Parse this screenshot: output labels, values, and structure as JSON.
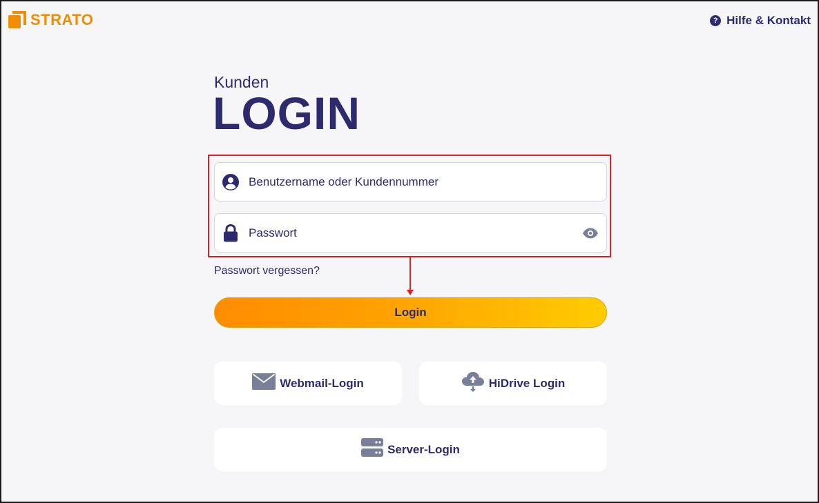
{
  "brand": {
    "name": "STRATO",
    "color": "#f28c00"
  },
  "header": {
    "help_label": "Hilfe & Kontakt",
    "help_icon": "question-circle-icon"
  },
  "headline": {
    "small": "Kunden",
    "big": "LOGIN"
  },
  "form": {
    "username": {
      "placeholder": "Benutzername oder Kundennummer",
      "value": "",
      "icon": "user-circle-icon"
    },
    "password": {
      "placeholder": "Passwort",
      "value": "",
      "icon": "lock-icon",
      "toggle_icon": "eye-icon"
    },
    "forgot_label": "Passwort vergessen?",
    "submit_label": "Login"
  },
  "tiles": {
    "webmail": {
      "label": "Webmail-Login",
      "icon": "envelope-icon"
    },
    "hidrive": {
      "label": "HiDrive Login",
      "icon": "cloud-upload-icon"
    },
    "server": {
      "label": "Server-Login",
      "icon": "server-icon"
    }
  },
  "colors": {
    "text": "#2d2a6e",
    "accent_start": "#ff8c00",
    "accent_end": "#ffcc00",
    "annotation": "#e01f1f"
  }
}
